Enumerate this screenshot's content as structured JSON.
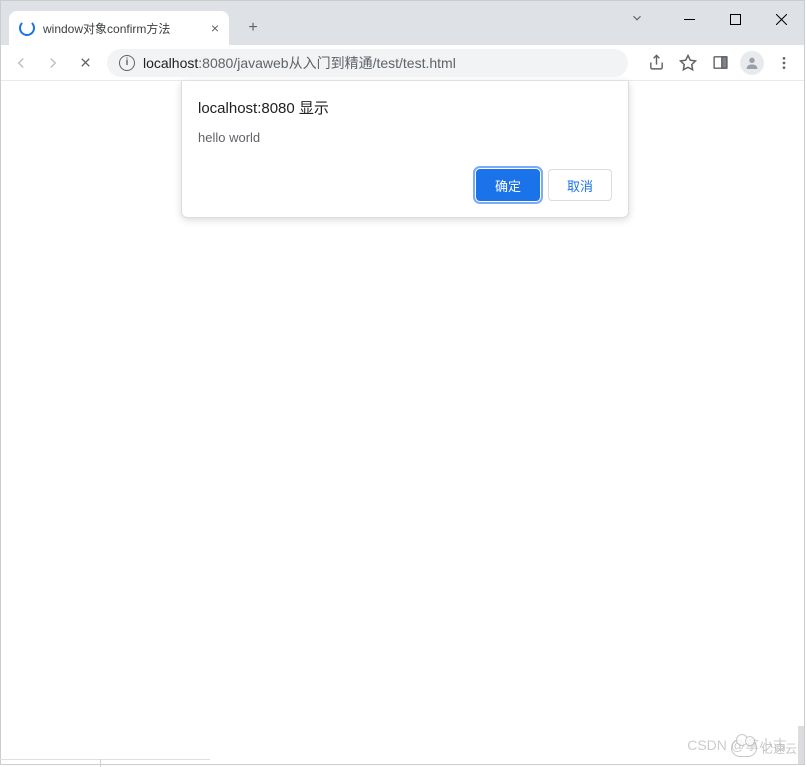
{
  "window": {
    "tab_title": "window对象confirm方法",
    "controls": {
      "minimize": "—",
      "maximize": "☐",
      "close": "✕"
    }
  },
  "toolbar": {
    "url": {
      "domain": "localhost",
      "port": ":8080",
      "path": "/javaweb从入门到精通/test/test.html"
    }
  },
  "dialog": {
    "title": "localhost:8080 显示",
    "message": "hello world",
    "ok_label": "确定",
    "cancel_label": "取消"
  },
  "watermark": {
    "text": "CSDN @拿小古",
    "logo_text": "亿速云"
  }
}
